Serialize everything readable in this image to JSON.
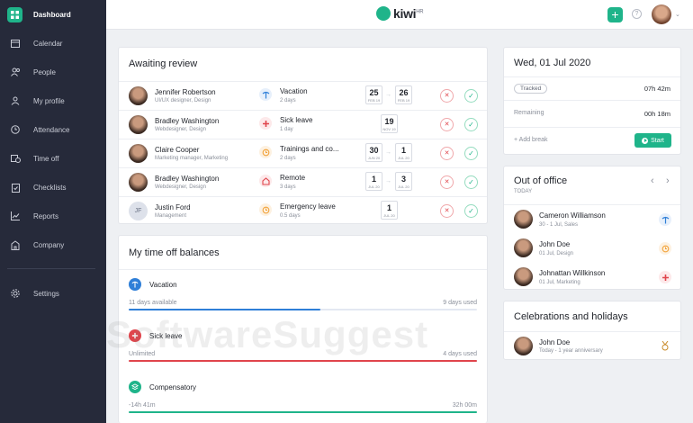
{
  "sidebar": {
    "items": [
      {
        "label": "Dashboard",
        "icon": "grid-icon",
        "active": true
      },
      {
        "label": "Calendar",
        "icon": "calendar-icon"
      },
      {
        "label": "People",
        "icon": "people-icon"
      },
      {
        "label": "My profile",
        "icon": "user-icon"
      },
      {
        "label": "Attendance",
        "icon": "clock-icon"
      },
      {
        "label": "Time off",
        "icon": "calendar-clock-icon"
      },
      {
        "label": "Checklists",
        "icon": "clipboard-icon"
      },
      {
        "label": "Reports",
        "icon": "chart-icon"
      },
      {
        "label": "Company",
        "icon": "building-icon"
      }
    ],
    "settings": {
      "label": "Settings",
      "icon": "gear-icon"
    }
  },
  "header": {
    "brand": "kiwi",
    "brand_sup": "HR",
    "add_label": "+",
    "help_label": "?"
  },
  "awaiting": {
    "title": "Awaiting review",
    "rows": [
      {
        "name": "Jennifer Robertson",
        "role": "UI/UX designer, Design",
        "type": "Vacation",
        "duration": "2 days",
        "from_d": "25",
        "from_m": "FEB 19",
        "to_d": "26",
        "to_m": "FEB 19"
      },
      {
        "name": "Bradley Washington",
        "role": "Webdesigner, Design",
        "type": "Sick leave",
        "duration": "1 day",
        "from_d": "19",
        "from_m": "NOV 19",
        "to_d": "",
        "to_m": ""
      },
      {
        "name": "Claire Cooper",
        "role": "Marketing manager, Marketing",
        "type": "Trainings and co...",
        "duration": "2 days",
        "from_d": "30",
        "from_m": "JUN 20",
        "to_d": "1",
        "to_m": "JUL 20"
      },
      {
        "name": "Bradley Washington",
        "role": "Webdesigner, Design",
        "type": "Remote",
        "duration": "3 days",
        "from_d": "1",
        "from_m": "JUL 20",
        "to_d": "3",
        "to_m": "JUL 20"
      },
      {
        "name": "Justin Ford",
        "role": "Management",
        "initials": "JF",
        "type": "Emergency leave",
        "duration": "0.5 days",
        "from_d": "1",
        "from_m": "JUL 20",
        "to_d": "",
        "to_m": ""
      }
    ]
  },
  "balances": {
    "title": "My time off balances",
    "items": [
      {
        "name": "Vacation",
        "left": "11 days available",
        "right": "9 days used",
        "fill": 0.55,
        "color": "#2f7fd8"
      },
      {
        "name": "Sick leave",
        "left": "Unlimited",
        "right": "4 days used",
        "fill": 1.0,
        "color": "#e0454c"
      },
      {
        "name": "Compensatory",
        "left": "-14h 41m",
        "right": "32h 00m",
        "fill": 1.0,
        "color": "#1fb48a"
      }
    ]
  },
  "today": {
    "date": "Wed, 01 Jul 2020",
    "tracked_label": "Tracked",
    "tracked_value": "07h 42m",
    "remaining_label": "Remaining",
    "remaining_value": "00h 18m",
    "add_break": "+ Add break",
    "start_label": "Start"
  },
  "out_of_office": {
    "title": "Out of office",
    "subtitle": "TODAY",
    "people": [
      {
        "name": "Cameron Williamson",
        "detail": "30 - 1 Jul, Sales",
        "kind": "vacation"
      },
      {
        "name": "John Doe",
        "detail": "01 Jul, Design",
        "kind": "training"
      },
      {
        "name": "Johnattan Willkinson",
        "detail": "01 Jul, Marketing",
        "kind": "sick"
      }
    ]
  },
  "celebrations": {
    "title": "Celebrations and holidays",
    "people": [
      {
        "name": "John Doe",
        "detail": "Today - 1 year anniversary"
      }
    ]
  },
  "watermark": "SoftwareSuggest",
  "colors": {
    "accent": "#1fb48a",
    "sidebar": "#262a3a",
    "vacation": "#2f7fd8",
    "sick": "#e0454c",
    "training": "#f2a33a",
    "remote": "#e0454c"
  }
}
